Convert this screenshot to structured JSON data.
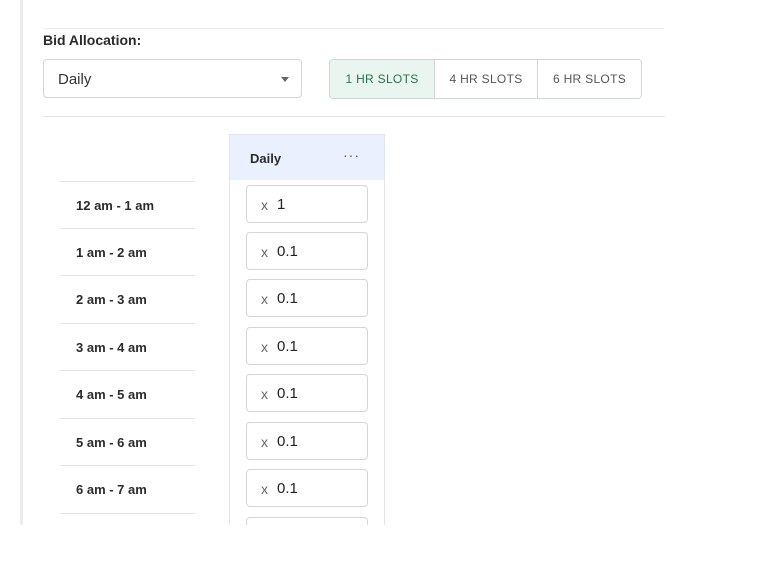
{
  "bid_allocation": {
    "label": "Bid Allocation:",
    "dropdown_value": "Daily",
    "slot_options": [
      {
        "label": "1 HR SLOTS",
        "active": true
      },
      {
        "label": "4 HR SLOTS",
        "active": false
      },
      {
        "label": "6 HR SLOTS",
        "active": false
      }
    ]
  },
  "table": {
    "column_header": "Daily",
    "more_label": "···",
    "multiplier_prefix": "x",
    "rows": [
      {
        "time": "12 am - 1 am",
        "multiplier": "1"
      },
      {
        "time": "1 am - 2 am",
        "multiplier": "0.1"
      },
      {
        "time": "2 am - 3 am",
        "multiplier": "0.1"
      },
      {
        "time": "3 am - 4 am",
        "multiplier": "0.1"
      },
      {
        "time": "4 am - 5 am",
        "multiplier": "0.1"
      },
      {
        "time": "5 am - 6 am",
        "multiplier": "0.1"
      },
      {
        "time": "6 am - 7 am",
        "multiplier": "0.1"
      },
      {
        "time": "",
        "multiplier": ""
      }
    ]
  },
  "colors": {
    "active_segment_bg": "#e9f5ef",
    "active_segment_text": "#2e6d4f",
    "column_header_bg": "#eaf0fd"
  }
}
